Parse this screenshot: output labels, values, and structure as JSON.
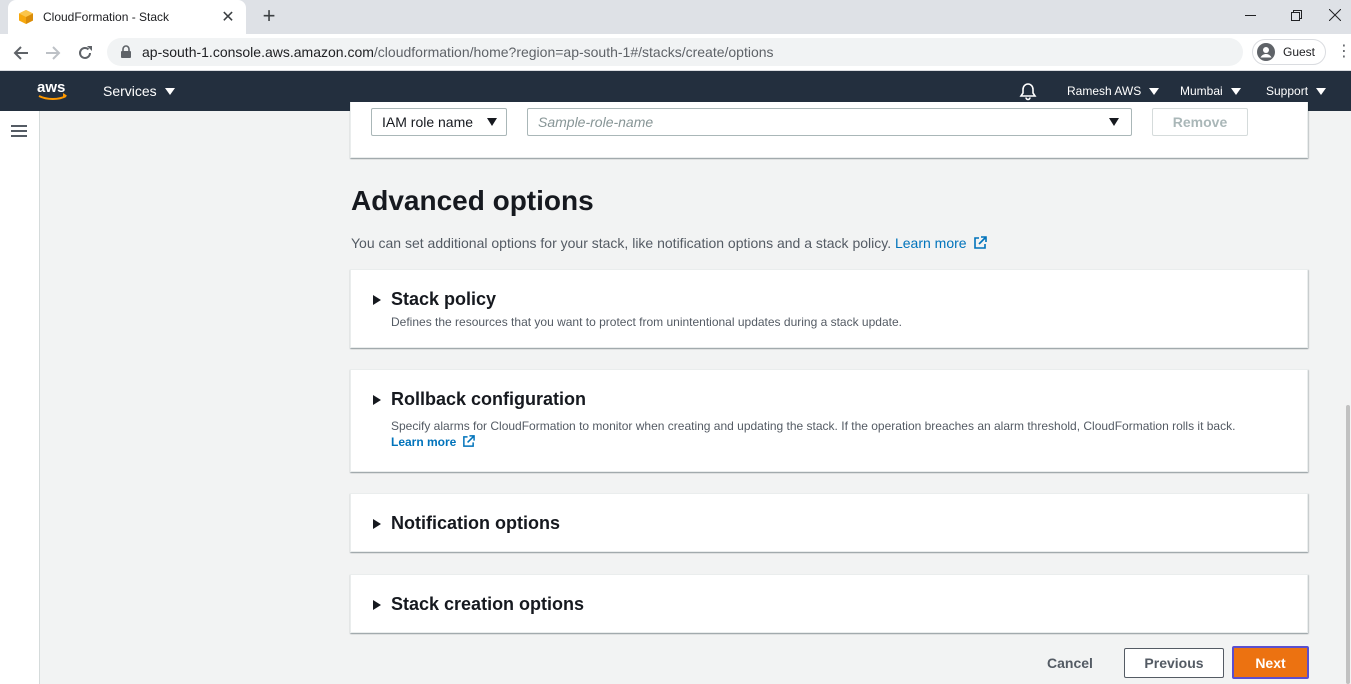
{
  "browser": {
    "tab_title": "CloudFormation - Stack",
    "new_tab": "+",
    "url_host": "ap-south-1.console.aws.amazon.com",
    "url_path": "/cloudformation/home?region=ap-south-1#/stacks/create/options",
    "profile_label": "Guest"
  },
  "aws_nav": {
    "services": "Services",
    "user": "Ramesh AWS",
    "region": "Mumbai",
    "support": "Support"
  },
  "iam": {
    "type_label": "IAM role name",
    "placeholder": "Sample-role-name",
    "remove_label": "Remove"
  },
  "advanced": {
    "heading": "Advanced options",
    "description": "You can set additional options for your stack, like notification options and a stack policy.",
    "learn_more": "Learn more"
  },
  "sections": {
    "stack_policy": {
      "title": "Stack policy",
      "description": "Defines the resources that you want to protect from unintentional updates during a stack update."
    },
    "rollback": {
      "title": "Rollback configuration",
      "description": "Specify alarms for CloudFormation to monitor when creating and updating the stack. If the operation breaches an alarm threshold, CloudFormation rolls it back.",
      "learn_more": "Learn more"
    },
    "notification": {
      "title": "Notification options"
    },
    "stack_creation": {
      "title": "Stack creation options"
    }
  },
  "actions": {
    "cancel": "Cancel",
    "previous": "Previous",
    "next": "Next"
  },
  "colors": {
    "aws_nav_bg": "#232f3e",
    "primary_button": "#ec7211",
    "link": "#0073bb",
    "focus_ring": "#5a4fcf"
  }
}
